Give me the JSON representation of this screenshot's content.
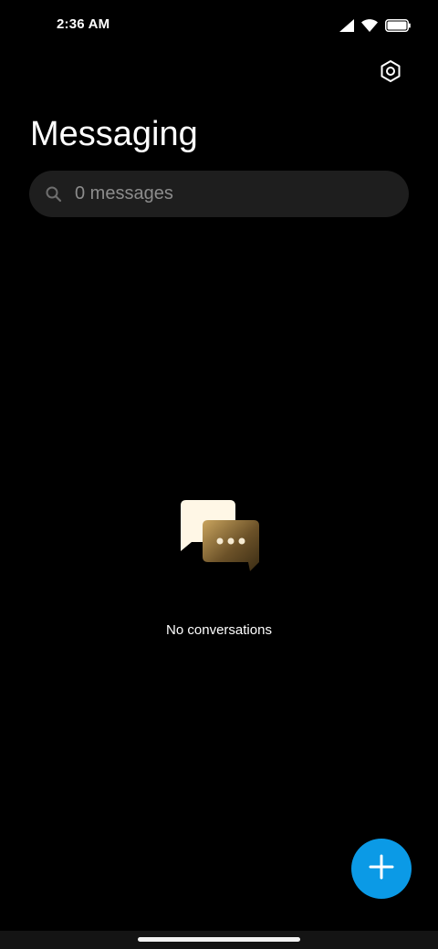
{
  "status_bar": {
    "time": "2:36 AM",
    "icons": [
      "signal-icon",
      "wifi-icon",
      "battery-icon"
    ]
  },
  "header": {
    "title": "Messaging",
    "settings_icon": "gear-icon"
  },
  "search": {
    "placeholder": "0 messages",
    "icon": "search-icon"
  },
  "empty_state": {
    "message": "No conversations",
    "icon": "chat-bubbles-icon"
  },
  "fab": {
    "icon": "plus-icon",
    "color": "#0b9ae6"
  },
  "colors": {
    "background": "#000000",
    "search_bg": "#1e1e1e",
    "placeholder": "#8c8c8c",
    "accent": "#0b9ae6"
  }
}
